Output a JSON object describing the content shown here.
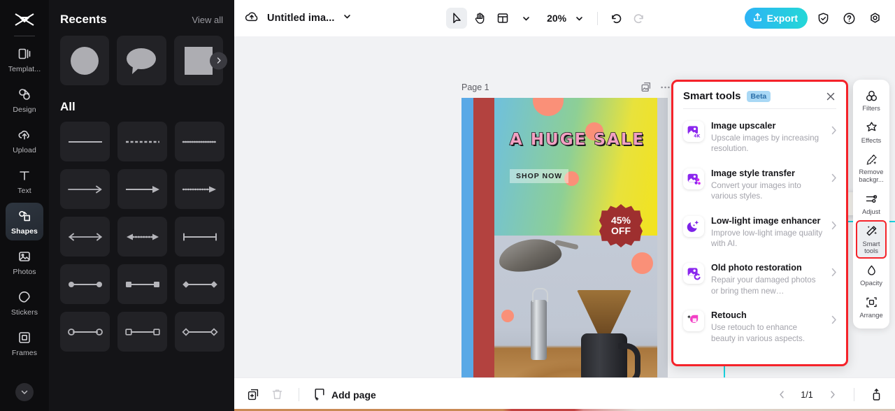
{
  "rail": {
    "logo_icon": "capcut-logo-icon",
    "items": [
      {
        "label": "Templat...",
        "icon": "template-icon",
        "active": false
      },
      {
        "label": "Design",
        "icon": "design-icon",
        "active": false
      },
      {
        "label": "Upload",
        "icon": "upload-cloud-icon",
        "active": false
      },
      {
        "label": "Text",
        "icon": "text-icon",
        "active": false
      },
      {
        "label": "Shapes",
        "icon": "shapes-icon",
        "active": true
      },
      {
        "label": "Photos",
        "icon": "photos-icon",
        "active": false
      },
      {
        "label": "Stickers",
        "icon": "stickers-icon",
        "active": false
      },
      {
        "label": "Frames",
        "icon": "frames-icon",
        "active": false
      }
    ],
    "more_icon": "chevron-down-icon"
  },
  "panel": {
    "recents_title": "Recents",
    "view_all": "View all",
    "recents": [
      {
        "shape": "circle",
        "name": "shape-circle"
      },
      {
        "shape": "speech-bubble",
        "name": "shape-speech-bubble"
      },
      {
        "shape": "square",
        "name": "shape-square"
      }
    ],
    "next_icon": "chevron-right-icon",
    "all_title": "All",
    "shapes": [
      {
        "name": "line-solid"
      },
      {
        "name": "line-dashed"
      },
      {
        "name": "line-dotted"
      },
      {
        "name": "arrow-open-right"
      },
      {
        "name": "arrow-solid-right"
      },
      {
        "name": "arrow-dotted-right"
      },
      {
        "name": "arrow-double-open"
      },
      {
        "name": "arrow-dotted-double"
      },
      {
        "name": "line-bar-ends"
      },
      {
        "name": "line-filled-circle-ends"
      },
      {
        "name": "line-filled-square-ends"
      },
      {
        "name": "line-filled-diamond-ends"
      },
      {
        "name": "line-open-circle-ends"
      },
      {
        "name": "line-open-square-ends"
      },
      {
        "name": "line-open-diamond-ends"
      }
    ],
    "collapse_icon": "chevron-left-icon"
  },
  "topbar": {
    "cloud_icon": "cloud-save-icon",
    "doc_title": "Untitled ima...",
    "title_caret_icon": "chevron-down-icon",
    "tools": [
      {
        "name": "select-tool",
        "icon": "cursor-icon",
        "selected": true
      },
      {
        "name": "hand-tool",
        "icon": "hand-icon",
        "selected": false
      },
      {
        "name": "layout-tool",
        "icon": "layout-icon",
        "selected": false
      }
    ],
    "layout_caret_icon": "chevron-down-icon",
    "zoom_value": "20%",
    "zoom_caret_icon": "chevron-down-icon",
    "undo_icon": "undo-icon",
    "redo_icon": "redo-icon",
    "export_label": "Export",
    "export_icon": "upload-share-icon",
    "export_color": "#24cfda",
    "shield_icon": "shield-check-icon",
    "help_icon": "question-circle-icon",
    "settings_icon": "gear-icon"
  },
  "canvas": {
    "page_label": "Page 1",
    "duplicate_page_icon": "duplicate-page-icon",
    "page_more_icon": "more-dots-icon",
    "context_tools": [
      {
        "name": "crop-button",
        "icon": "crop-icon"
      },
      {
        "name": "cutout-button",
        "icon": "cutout-icon"
      },
      {
        "name": "duplicate-button",
        "icon": "duplicate-icon"
      },
      {
        "name": "more-button",
        "icon": "more-dots-icon"
      }
    ],
    "artboard": {
      "headline": "A  HUGE  SALE",
      "cta": "SHOP NOW",
      "badge_top": "45%",
      "badge_bottom": "OFF",
      "left_stripe_color": "#5aa9e6",
      "second_stripe_color": "#b3423f",
      "badge_color": "#9e2f2f",
      "dot_color": "#fa9078"
    }
  },
  "smart_tools": {
    "title": "Smart tools",
    "badge": "Beta",
    "close_icon": "close-icon",
    "items": [
      {
        "name": "Image upscaler",
        "desc": "Upscale images by increasing resolution.",
        "icon": "image-upscaler-4k-icon",
        "arrow": "chevron-right-icon"
      },
      {
        "name": "Image style transfer",
        "desc": "Convert your images into various styles.",
        "icon": "style-transfer-icon",
        "arrow": "chevron-right-icon"
      },
      {
        "name": "Low-light image enhancer",
        "desc": "Improve low-light image quality with AI.",
        "icon": "moon-sparkle-icon",
        "arrow": "chevron-right-icon"
      },
      {
        "name": "Old photo restoration",
        "desc": "Repair your damaged photos or bring them new…",
        "icon": "photo-restore-icon",
        "arrow": "chevron-right-icon"
      },
      {
        "name": "Retouch",
        "desc": "Use retouch to enhance beauty in various aspects.",
        "icon": "retouch-sparkle-icon",
        "arrow": "chevron-right-icon"
      }
    ],
    "highlight_color": "#f5232a"
  },
  "right_toolbar": {
    "items": [
      {
        "label": "Filters",
        "icon": "filters-icon",
        "highlighted": false
      },
      {
        "label": "Effects",
        "icon": "effects-icon",
        "highlighted": false
      },
      {
        "label": "Remove backgr...",
        "icon": "remove-background-icon",
        "highlighted": false
      },
      {
        "label": "Adjust",
        "icon": "adjust-sliders-icon",
        "highlighted": false
      },
      {
        "label": "Smart tools",
        "icon": "magic-wand-icon",
        "highlighted": true
      },
      {
        "label": "Opacity",
        "icon": "opacity-drop-icon",
        "highlighted": false
      },
      {
        "label": "Arrange",
        "icon": "arrange-icon",
        "highlighted": false
      }
    ]
  },
  "bottombar": {
    "duplicate_icon": "duplicate-page-icon",
    "delete_icon": "trash-icon",
    "add_page_label": "Add page",
    "add_page_icon": "add-page-icon",
    "prev_icon": "chevron-left-icon",
    "next_icon": "chevron-right-icon",
    "page_indicator": "1/1",
    "expand_icon": "expand-panel-icon"
  }
}
